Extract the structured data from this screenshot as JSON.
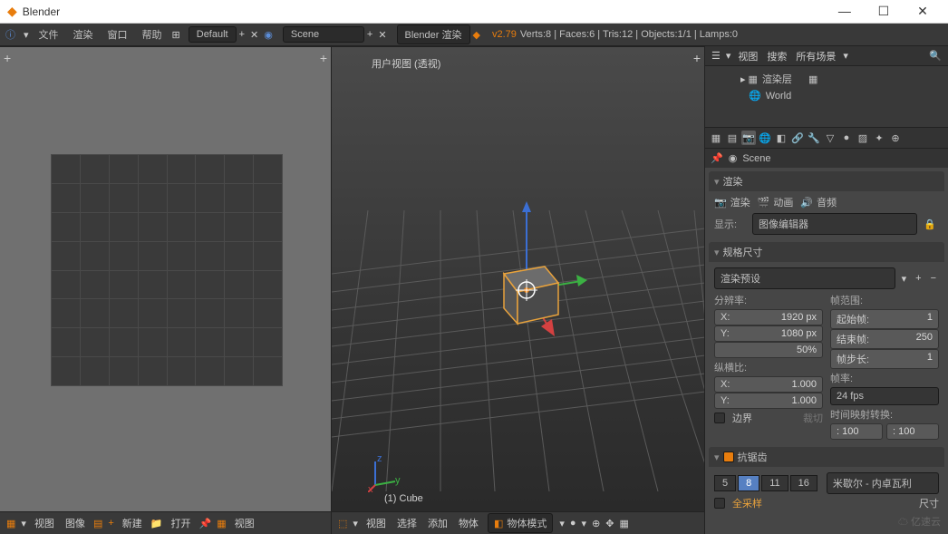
{
  "window": {
    "title": "Blender"
  },
  "topbar": {
    "menus": [
      "文件",
      "渲染",
      "窗口",
      "帮助"
    ],
    "layout": "Default",
    "scene_label": "Scene",
    "engine": "Blender 渲染",
    "version": "v2.79",
    "stats": "Verts:8 | Faces:6 | Tris:12 | Objects:1/1 | Lamps:0"
  },
  "uv_editor": {
    "footer": {
      "view": "视图",
      "image": "图像",
      "new": "新建",
      "open": "打开",
      "view2": "视图"
    }
  },
  "viewport": {
    "top_label": "用户视图 (透视)",
    "bottom_label": "(1) Cube",
    "footer": {
      "view": "视图",
      "select": "选择",
      "add": "添加",
      "object": "物体",
      "mode": "物体模式"
    }
  },
  "outliner": {
    "header": {
      "view": "视图",
      "search": "搜索",
      "filter": "所有场景"
    },
    "items": [
      {
        "icon": "layers",
        "label": "渲染层"
      },
      {
        "icon": "world",
        "label": "World"
      }
    ]
  },
  "properties": {
    "scene_label": "Scene",
    "render": {
      "header": "渲染",
      "buttons": {
        "render": "渲染",
        "animation": "动画",
        "audio": "音频"
      },
      "display_label": "显示:",
      "display_value": "图像编辑器"
    },
    "dimensions": {
      "header": "规格尺寸",
      "preset": "渲染预设",
      "resolution_label": "分辨率:",
      "res_x": "1920 px",
      "res_y": "1080 px",
      "res_pct": "50%",
      "frame_range_label": "帧范围:",
      "frame_start_label": "起始帧:",
      "frame_start": "1",
      "frame_end_label": "结束帧:",
      "frame_end": "250",
      "frame_step_label": "帧步长:",
      "frame_step": "1",
      "aspect_label": "纵横比:",
      "aspect_x": "1.000",
      "aspect_y": "1.000",
      "border_label": "边界",
      "crop_label": "裁切",
      "framerate_label": "帧率:",
      "framerate": "24 fps",
      "timeremap_label": "时间映射转换:",
      "timeremap_old": ": 100",
      "timeremap_new": ": 100"
    },
    "antialias": {
      "header": "抗锯齿",
      "samples": [
        "5",
        "8",
        "11",
        "16"
      ],
      "active_sample": "8",
      "fullsample": "全采样",
      "size_label": "尺寸",
      "filter": "米歇尔 - 内卓瓦利"
    }
  },
  "watermark": "亿速云"
}
